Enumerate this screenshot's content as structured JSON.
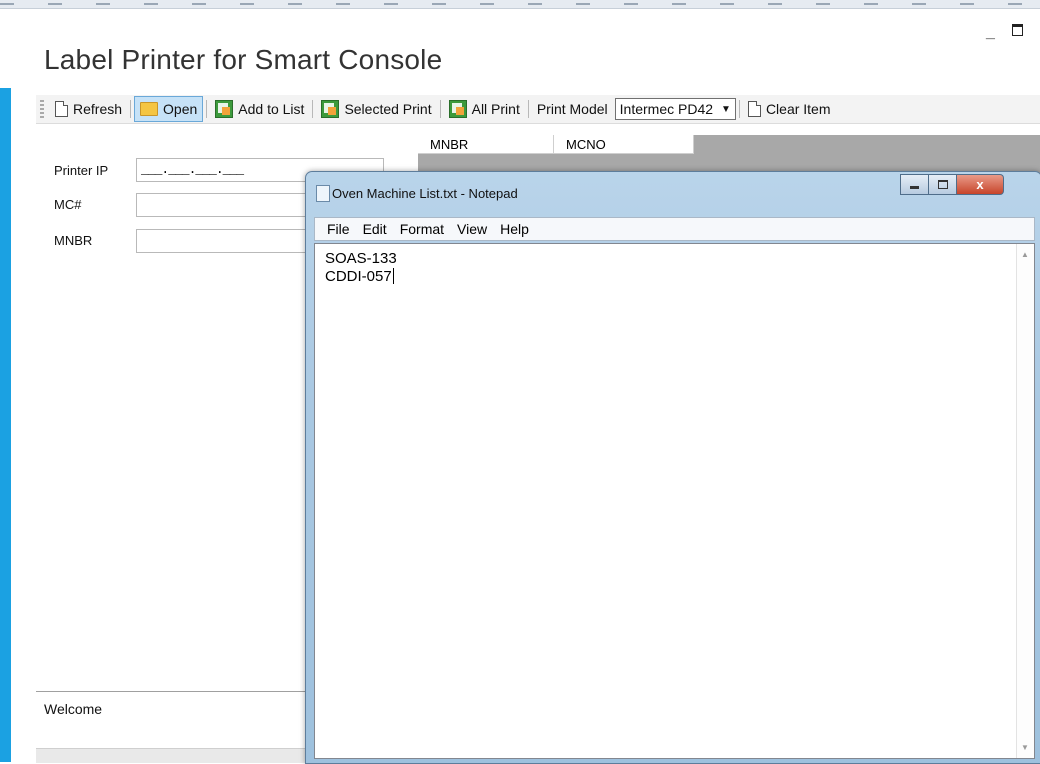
{
  "app": {
    "title": "Label Printer for Smart Console",
    "minimize_glyph": "_",
    "maximize_glyph": ""
  },
  "toolbar": {
    "refresh_label": "Refresh",
    "open_label": "Open",
    "add_to_list_label": "Add to List",
    "selected_print_label": "Selected Print",
    "all_print_label": "All Print",
    "print_model_label": "Print Model",
    "print_model_value": "Intermec PD42",
    "clear_item_label": "Clear Item"
  },
  "form": {
    "printer_ip_label": "Printer IP",
    "printer_ip_mask": "___.___.___.___",
    "mc_label": "MC#",
    "mnbr_label": "MNBR"
  },
  "grid": {
    "columns": [
      "MNBR",
      "MCNO"
    ]
  },
  "status": {
    "text": "Welcome"
  },
  "notepad": {
    "title": "Oven Machine List.txt - Notepad",
    "close_glyph": "x",
    "menu": [
      "File",
      "Edit",
      "Format",
      "View",
      "Help"
    ],
    "lines": [
      "SOAS-133",
      "CDDI-057"
    ]
  }
}
